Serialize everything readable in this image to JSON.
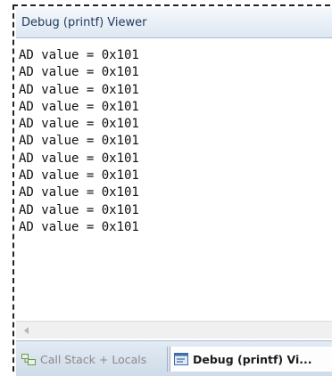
{
  "window": {
    "title": "Debug (printf) Viewer"
  },
  "output": {
    "lines": [
      "AD value = 0x101",
      "AD value = 0x101",
      "AD value = 0x101",
      "AD value = 0x101",
      "AD value = 0x101",
      "AD value = 0x101",
      "AD value = 0x101",
      "AD value = 0x101",
      "AD value = 0x101",
      "AD value = 0x101",
      "AD value = 0x101"
    ]
  },
  "tabs": [
    {
      "label": "Call Stack + Locals",
      "icon": "call-stack-icon",
      "active": false
    },
    {
      "label": "Debug (printf) Vi...",
      "icon": "debug-printf-icon",
      "active": true
    }
  ],
  "colors": {
    "title_text": "#1e395b",
    "tab_active_bg": "#fdfdfd"
  }
}
